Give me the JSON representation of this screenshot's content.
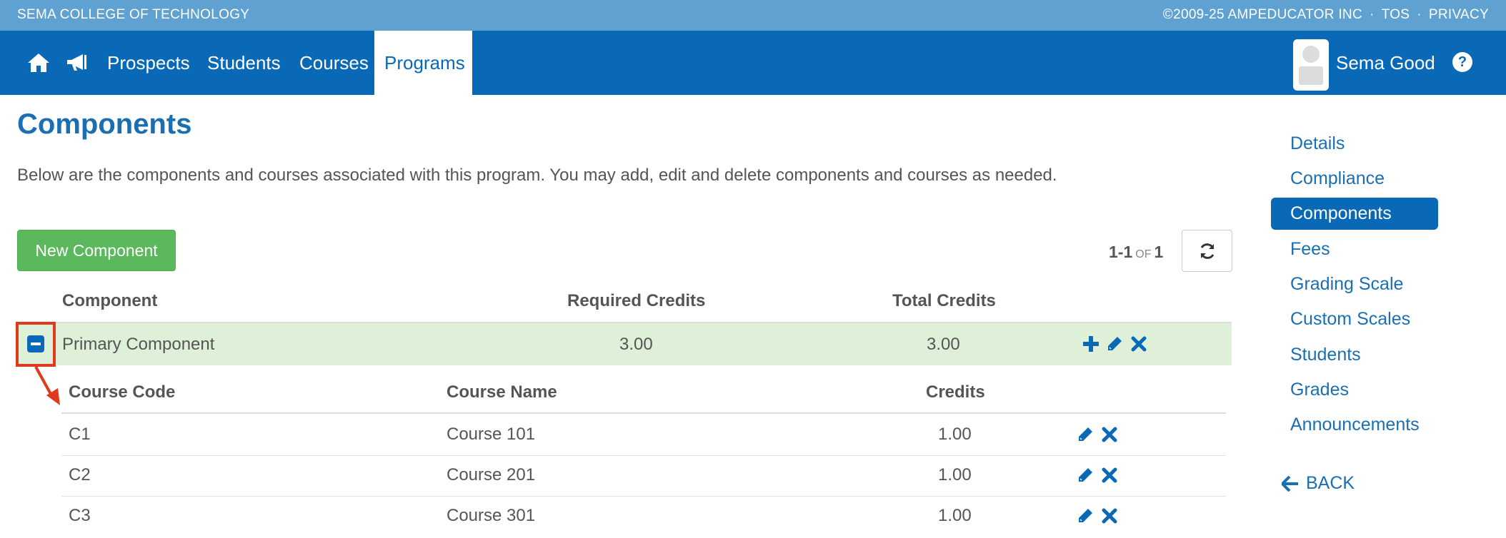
{
  "topbar": {
    "org": "SEMA COLLEGE OF TECHNOLOGY",
    "copyright": "©2009-25 AMPEDUCATOR INC",
    "tos": "TOS",
    "privacy": "PRIVACY",
    "separator": "·"
  },
  "nav": {
    "icons": [
      "home-icon",
      "bullhorn-icon"
    ],
    "links": [
      "Prospects",
      "Students",
      "Courses",
      "Programs"
    ],
    "active": "Programs",
    "user": "Sema Good",
    "help_glyph": "?"
  },
  "page": {
    "title": "Components",
    "intro": "Below are the components and courses associated with this program. You may add, edit and delete components and courses as needed.",
    "new_button": "New Component",
    "pager": {
      "range": "1-1",
      "of": "OF",
      "total": "1"
    }
  },
  "table": {
    "headers": [
      "Component",
      "Required Credits",
      "Total Credits"
    ],
    "row": {
      "name": "Primary Component",
      "required": "3.00",
      "total": "3.00"
    },
    "sub_headers": [
      "Course Code",
      "Course Name",
      "Credits"
    ],
    "courses": [
      {
        "code": "C1",
        "name": "Course 101",
        "credits": "1.00"
      },
      {
        "code": "C2",
        "name": "Course 201",
        "credits": "1.00"
      },
      {
        "code": "C3",
        "name": "Course 301",
        "credits": "1.00"
      }
    ]
  },
  "sidebar": {
    "items": [
      "Details",
      "Compliance",
      "Components",
      "Fees",
      "Grading Scale",
      "Custom Scales",
      "Students",
      "Grades",
      "Announcements"
    ],
    "active": "Components",
    "back": "BACK"
  },
  "colors": {
    "primary": "#0a69b7",
    "topbar": "#5fa2d2",
    "success": "#5cb85c",
    "row_highlight": "#dff0d8",
    "annotation": "#e03a1e"
  }
}
